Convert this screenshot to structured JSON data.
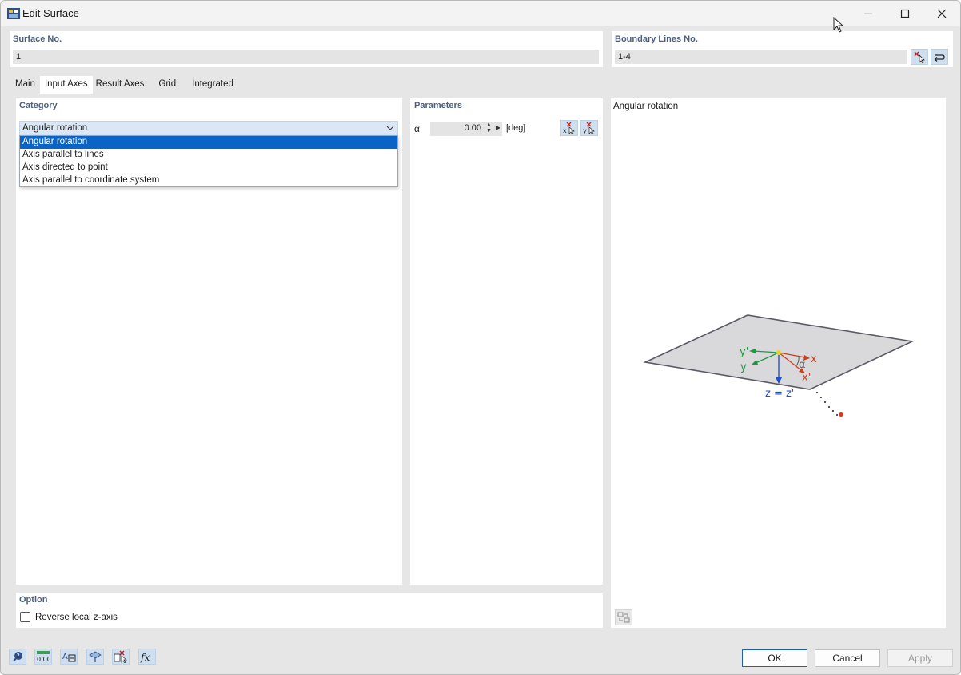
{
  "window": {
    "title": "Edit Surface"
  },
  "surface": {
    "label": "Surface No.",
    "value": "1"
  },
  "boundary": {
    "label": "Boundary Lines No.",
    "value": "1-4"
  },
  "tabs": [
    {
      "label": "Main",
      "active": false
    },
    {
      "label": "Input Axes",
      "active": true
    },
    {
      "label": "Result Axes",
      "active": false
    },
    {
      "label": "Grid",
      "active": false
    },
    {
      "label": "Integrated",
      "active": false
    }
  ],
  "category": {
    "label": "Category",
    "selected": "Angular rotation",
    "options": [
      "Angular rotation",
      "Axis parallel to lines",
      "Axis directed to point",
      "Axis parallel to coordinate system"
    ]
  },
  "parameters": {
    "label": "Parameters",
    "alpha_symbol": "α",
    "alpha_value": "0.00",
    "alpha_unit": "[deg]"
  },
  "preview": {
    "title": "Angular rotation",
    "labels": {
      "y_prime": "y'",
      "y": "y",
      "x": "x",
      "x_prime": "x'",
      "alpha": "α",
      "z": "z = z'"
    },
    "colors": {
      "surface_fill": "#d9d9dc",
      "surface_edge": "#5a5a66",
      "x_axis": "#c8401e",
      "y_axis": "#1e9a3c",
      "z_axis": "#1f4fd0",
      "origin": "#f0d020",
      "point": "#c8401e"
    }
  },
  "option": {
    "label": "Option",
    "reverse_label": "Reverse local z-axis",
    "reverse_checked": false
  },
  "footer": {
    "ok": "OK",
    "cancel": "Cancel",
    "apply": "Apply",
    "tool_icons": [
      "help-icon",
      "units-icon",
      "text-edit-icon",
      "view-icon",
      "select-icon",
      "formula-icon"
    ],
    "units_text": "0.00",
    "formula_text": "fx"
  },
  "colors": {
    "accent": "#0a64c8",
    "section_label": "#4c5f80",
    "icon_button": "#cfdff0"
  }
}
